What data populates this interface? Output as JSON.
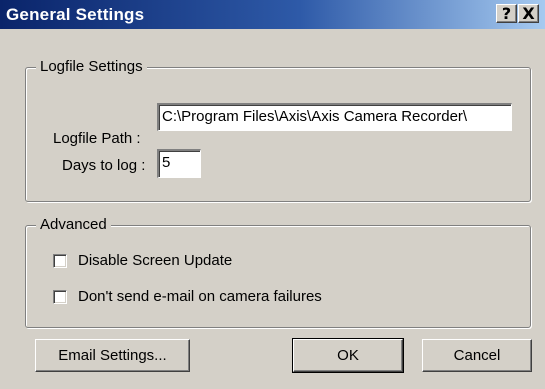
{
  "window": {
    "title": "General Settings",
    "help_glyph": "?",
    "close_glyph": "X"
  },
  "logfile_group": {
    "legend": "Logfile Settings",
    "path_label": "Logfile Path :",
    "path_value": "C:\\Program Files\\Axis\\Axis Camera Recorder\\",
    "days_label": "Days to log :",
    "days_value": "5"
  },
  "advanced_group": {
    "legend": "Advanced",
    "options": [
      {
        "label": "Disable Screen Update",
        "checked": false
      },
      {
        "label": "Don't send e-mail on camera failures",
        "checked": false
      }
    ]
  },
  "buttons": {
    "email_settings": "Email Settings...",
    "ok": "OK",
    "cancel": "Cancel"
  },
  "colors": {
    "title_start": "#0a246a",
    "title_end": "#a6caf0",
    "face": "#d4d0c8"
  }
}
